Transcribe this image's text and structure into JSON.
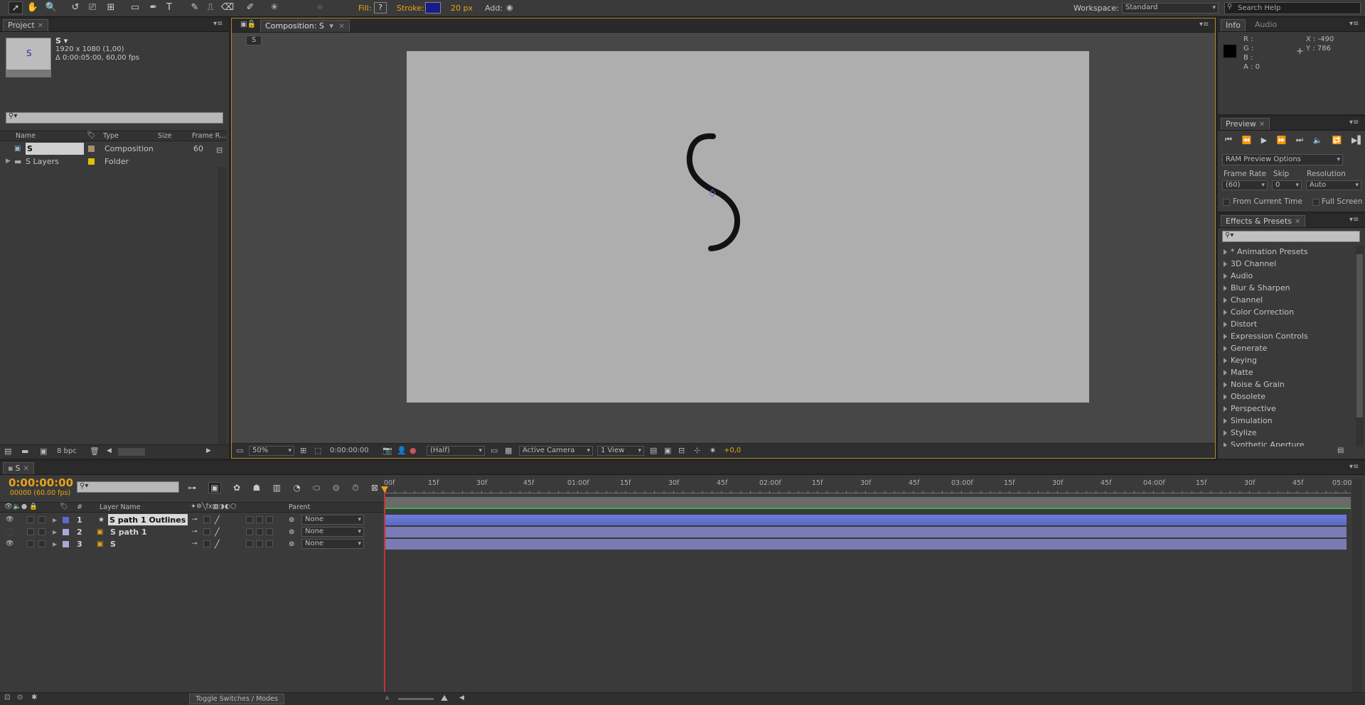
{
  "toolbar": {
    "fill_label": "Fill:",
    "fill_value": "?",
    "stroke_label": "Stroke:",
    "stroke_width": "20 px",
    "add_label": "Add:",
    "workspace_label": "Workspace:",
    "workspace_value": "Standard",
    "search_placeholder": "Search Help",
    "stroke_color": "#1a1a8c"
  },
  "project": {
    "tab": "Project",
    "item_name": "S ▾",
    "item_info1": "1920 x 1080 (1,00)",
    "item_info2": "Δ 0:00:05:00, 60,00 fps",
    "columns": [
      "Name",
      "Type",
      "Size",
      "Frame R..."
    ],
    "items": [
      {
        "name": "S",
        "type": "Composition",
        "size": "",
        "fps": "60",
        "color": "#a88f74"
      },
      {
        "name": "S Layers",
        "type": "Folder",
        "size": "",
        "fps": "",
        "color": "#e0c000"
      }
    ],
    "bpc": "8 bpc"
  },
  "composition": {
    "tab": "Composition: S",
    "breadcrumb": "S",
    "zoom": "50%",
    "timecode": "0:00:00:00",
    "resolution": "(Half)",
    "camera": "Active Camera",
    "view": "1 View",
    "exposure": "+0,0"
  },
  "info": {
    "tab_info": "Info",
    "tab_audio": "Audio",
    "r": "R :",
    "g": "G :",
    "b": "B :",
    "a": "A : 0",
    "x": "X : -490",
    "y": "Y : 786"
  },
  "preview": {
    "tab": "Preview",
    "ram_options": "RAM Preview Options",
    "frame_rate_label": "Frame Rate",
    "skip_label": "Skip",
    "resolution_label": "Resolution",
    "frame_rate": "(60)",
    "skip": "0",
    "resolution": "Auto",
    "from_current": "From Current Time",
    "full_screen": "Full Screen"
  },
  "effects": {
    "tab": "Effects & Presets",
    "items": [
      "* Animation Presets",
      "3D Channel",
      "Audio",
      "Blur & Sharpen",
      "Channel",
      "Color Correction",
      "Distort",
      "Expression Controls",
      "Generate",
      "Keying",
      "Matte",
      "Noise & Grain",
      "Obsolete",
      "Perspective",
      "Simulation",
      "Stylize",
      "Synthetic Aperture"
    ]
  },
  "timeline": {
    "tab": "S",
    "timecode": "0:00:00:00",
    "frame_info": "00000 (60.00 fps)",
    "col_hash": "#",
    "col_layer": "Layer Name",
    "col_parent": "Parent",
    "ticks": [
      "00f",
      "15f",
      "30f",
      "45f",
      "01:00f",
      "15f",
      "30f",
      "45f",
      "02:00f",
      "15f",
      "30f",
      "45f",
      "03:00f",
      "15f",
      "30f",
      "45f",
      "04:00f",
      "15f",
      "30f",
      "45f",
      "05:00"
    ],
    "layers": [
      {
        "num": "1",
        "name": "S path 1 Outlines",
        "parent": "None",
        "color": "#5b6ccd",
        "icon": "star",
        "visible": true
      },
      {
        "num": "2",
        "name": "S path 1",
        "parent": "None",
        "color": "#a9a9d8",
        "icon": "shape",
        "visible": false
      },
      {
        "num": "3",
        "name": "S",
        "parent": "None",
        "color": "#a9a9d8",
        "icon": "shape",
        "visible": true
      }
    ],
    "toggle": "Toggle Switches / Modes"
  }
}
